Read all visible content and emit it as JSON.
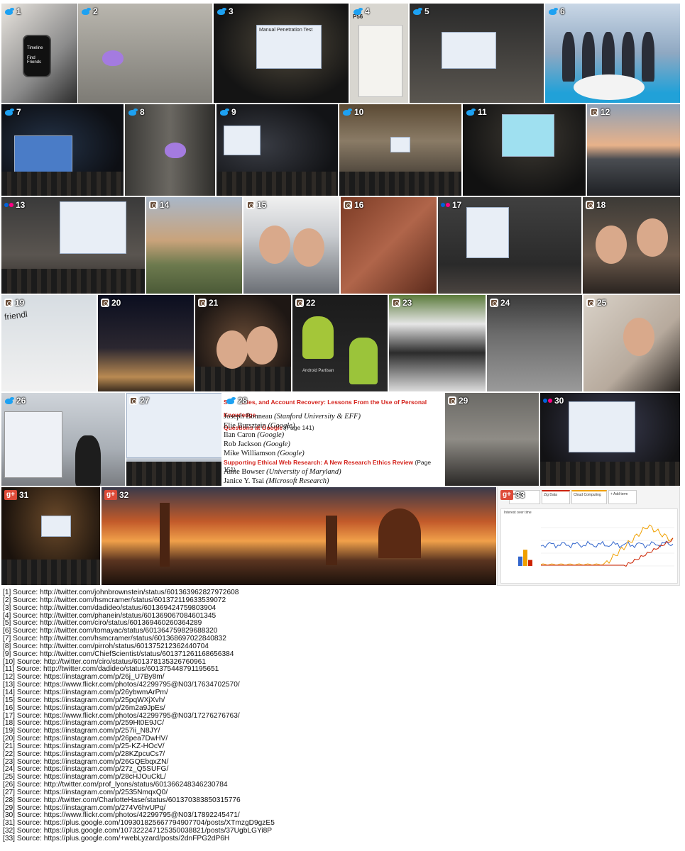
{
  "tiles": [
    {
      "n": "1",
      "platform": "twitter"
    },
    {
      "n": "2",
      "platform": "twitter"
    },
    {
      "n": "3",
      "platform": "twitter"
    },
    {
      "n": "4",
      "platform": "twitter"
    },
    {
      "n": "5",
      "platform": "twitter"
    },
    {
      "n": "6",
      "platform": "twitter"
    },
    {
      "n": "7",
      "platform": "twitter"
    },
    {
      "n": "8",
      "platform": "twitter"
    },
    {
      "n": "9",
      "platform": "twitter"
    },
    {
      "n": "10",
      "platform": "twitter"
    },
    {
      "n": "11",
      "platform": "twitter"
    },
    {
      "n": "12",
      "platform": "instagram"
    },
    {
      "n": "13",
      "platform": "flickr"
    },
    {
      "n": "14",
      "platform": "instagram"
    },
    {
      "n": "15",
      "platform": "instagram"
    },
    {
      "n": "16",
      "platform": "instagram"
    },
    {
      "n": "17",
      "platform": "flickr"
    },
    {
      "n": "18",
      "platform": "instagram"
    },
    {
      "n": "19",
      "platform": "instagram"
    },
    {
      "n": "20",
      "platform": "instagram"
    },
    {
      "n": "21",
      "platform": "instagram"
    },
    {
      "n": "22",
      "platform": "instagram"
    },
    {
      "n": "23",
      "platform": "instagram"
    },
    {
      "n": "24",
      "platform": "instagram"
    },
    {
      "n": "25",
      "platform": "instagram"
    },
    {
      "n": "26",
      "platform": "twitter"
    },
    {
      "n": "27",
      "platform": "instagram"
    },
    {
      "n": "28",
      "platform": "twitter"
    },
    {
      "n": "29",
      "platform": "instagram"
    },
    {
      "n": "30",
      "platform": "flickr"
    },
    {
      "n": "31",
      "platform": "googleplus"
    },
    {
      "n": "32",
      "platform": "googleplus"
    },
    {
      "n": "33",
      "platform": "googleplus"
    }
  ],
  "tile_text": {
    "t1_line1": "Timeline",
    "t1_line2": "Find Friends",
    "t4_label": "P56",
    "t3_slide": "Manual Penetration Test",
    "t11_slide": "",
    "t19_logo": "friendl",
    "t22_caption": "Android Partisan"
  },
  "paper": {
    "title1_pre": "S",
    "title1_rest": "...ies, and Account Recovery: Lessons From the Use of Personal Knowledge",
    "title1_line2": "Questions at Google",
    "title1_page": "(Page 141)",
    "authors1": [
      {
        "name": "Joseph Bonneau",
        "aff": "(Stanford University & EFF)"
      },
      {
        "name": "Elie Bursztein",
        "aff": "(Google)"
      },
      {
        "name": "Ilan Caron",
        "aff": "(Google)"
      },
      {
        "name": "Rob Jackson",
        "aff": "(Google)"
      },
      {
        "name": "Mike Williamson",
        "aff": "(Google)"
      }
    ],
    "title2": "Supporting Ethical Web Research: A New Research Ethics Review",
    "title2_page": "(Page 151)",
    "authors2": [
      {
        "name": "Anne Bowser",
        "aff": "(University of Maryland)"
      },
      {
        "name": "Janice Y. Tsai",
        "aff": "(Microsoft Research)"
      }
    ]
  },
  "trend": {
    "tab1": "ourship",
    "tab2": "Zig Data",
    "tab3": "Cloud Computing",
    "tab4": "+ Add term",
    "panel_title": "Interest over time",
    "colors": {
      "blue": "#3366cc",
      "orange": "#f0a000",
      "red": "#cc2200",
      "bar_blue": "#3366cc",
      "bar_orange": "#f0a000"
    },
    "bars": [
      0.55,
      0.95,
      0.35
    ]
  },
  "sources": [
    "[1] Source: http://twitter.com/johnbrownstein/status/601363962827972608",
    "[2] Source: http://twitter.com/hsmcramer/status/601372119633539072",
    "[3] Source: http://twitter.com/dadideo/status/601369424759803904",
    "[4] Source: http://twitter.com/phanein/status/601369067084601345",
    "[5] Source: http://twitter.com/ciro/status/601369460260364289",
    "[6] Source: http://twitter.com/tomayac/status/601364759829688320",
    "[7] Source: http://twitter.com/hsmcramer/status/601368697022840832",
    "[8] Source: http://twitter.com/pirroh/status/601375212362440704",
    "[9] Source: http://twitter.com/ChiefScientist/status/601371261168656384",
    "[10] Source: http://twitter.com/ciro/status/601378135326760961",
    "[11] Source: http://twitter.com/dadideo/status/601375448791195651",
    "[12] Source: https://instagram.com/p/26j_U7By8m/",
    "[13] Source: https://www.flickr.com/photos/42299795@N03/17634702570/",
    "[14] Source: https://instagram.com/p/26ybwmArPm/",
    "[15] Source: https://instagram.com/p/25pqWXjXvh/",
    "[16] Source: https://instagram.com/p/26m2a9JpEs/",
    "[17] Source: https://www.flickr.com/photos/42299795@N03/17276276763/",
    "[18] Source: https://instagram.com/p/259Ht0E9JC/",
    "[19] Source: https://instagram.com/p/257ii_N8JY/",
    "[20] Source: https://instagram.com/p/26pea7DwHV/",
    "[21] Source: https://instagram.com/p/25-KZ-HOcV/",
    "[22] Source: https://instagram.com/p/28KZpcuCs7/",
    "[23] Source: https://instagram.com/p/26GQEbqxZN/",
    "[24] Source: https://instagram.com/p/27z_Q5SUFG/",
    "[25] Source: https://instagram.com/p/28cHJOuCkL/",
    "[26] Source: http://twitter.com/prof_lyons/status/601366248346230784",
    "[27] Source: https://instagram.com/p/2535NmqxQ0/",
    "[28] Source: http://twitter.com/CharlotteHase/status/601370383850315776",
    "[29] Source: https://instagram.com/p/274V6hvUPq/",
    "[30] Source: https://www.flickr.com/photos/42299795@N03/17892245471/",
    "[31] Source: https://plus.google.com/109301825667794907704/posts/XTmzgD9gzE5",
    "[32] Source: https://plus.google.com/107322247125350038821/posts/37UgbLGYi8P",
    "[33] Source: https://plus.google.com/+webLyzard/posts/2dnFPG2dP6H"
  ]
}
